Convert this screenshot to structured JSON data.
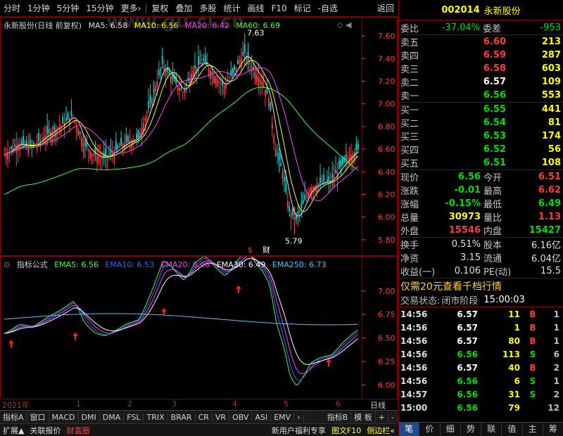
{
  "toolbar": [
    "分时",
    "1分钟",
    "5分钟",
    "15分钟",
    "更多›",
    "复权",
    "叠加",
    "多股",
    "统计",
    "画线",
    "F10",
    "标记",
    "-自选",
    "返回"
  ],
  "watermark": "www.gu-ci.cn",
  "main_legend": {
    "title": "永新股份(日线 前复权)",
    "ma5": "MA5: 6.58",
    "ma10": "MA10: 6.56",
    "ma20": "MA20: 6.42",
    "ma60": "MA60: 6.69"
  },
  "main_annot": {
    "high": "7.63",
    "low": "5.79",
    "s": "$",
    "cai": "财"
  },
  "main_axis": [
    "7.60",
    "7.40",
    "7.20",
    "7.00",
    "6.80",
    "6.60",
    "6.40",
    "6.20",
    "6.00",
    "5.80"
  ],
  "ind_legend": {
    "title": "指标公式",
    "ema5": "EMA5: 6.56",
    "ema10": "EMA10: 6.53",
    "ema20": "EMA20: 6.48",
    "ema30": "EMA30: 6.49",
    "ema250": "EMA250: 6.73"
  },
  "ind_axis": [
    "7.00",
    "6.75",
    "6.50",
    "6.25",
    "6.00"
  ],
  "dates": [
    "2021年",
    "1",
    "2",
    "3",
    "4",
    "5",
    "6"
  ],
  "period_label": "日线",
  "tabs": [
    "指标A",
    "窗口",
    "MACD",
    "DMI",
    "DMA",
    "FSL",
    "TRIX",
    "BRAR",
    "CR",
    "VR",
    "OBV",
    "ASI",
    "EMV",
    "›",
    "指标B",
    "模 板",
    "+",
    "-"
  ],
  "bottom": [
    "扩展▲",
    "关联报价",
    "财富圈",
    "新用户福利专享",
    "图文F10",
    "侧边栏«"
  ],
  "stock": {
    "code": "002014",
    "name": "永新股份"
  },
  "weibi": {
    "label1": "委比",
    "val1": "-37.04%",
    "label2": "委差",
    "val2": "-953"
  },
  "asks": [
    {
      "label": "卖五",
      "price": "6.60",
      "vol": "213"
    },
    {
      "label": "卖四",
      "price": "6.59",
      "vol": "287"
    },
    {
      "label": "卖三",
      "price": "6.58",
      "vol": "603"
    },
    {
      "label": "卖二",
      "price": "6.57",
      "vol": "109"
    },
    {
      "label": "卖一",
      "price": "6.56",
      "vol": "553"
    }
  ],
  "bids": [
    {
      "label": "买一",
      "price": "6.55",
      "vol": "441"
    },
    {
      "label": "买二",
      "price": "6.54",
      "vol": "81"
    },
    {
      "label": "买三",
      "price": "6.53",
      "vol": "174"
    },
    {
      "label": "买四",
      "price": "6.52",
      "vol": "56"
    },
    {
      "label": "买五",
      "price": "6.51",
      "vol": "108"
    }
  ],
  "stats": [
    {
      "l1": "现价",
      "v1": "6.56",
      "l2": "今开",
      "v2": "6.51"
    },
    {
      "l1": "涨跌",
      "v1": "-0.01",
      "l2": "最高",
      "v2": "6.62"
    },
    {
      "l1": "涨幅",
      "v1": "-0.15%",
      "l2": "最低",
      "v2": "6.49"
    },
    {
      "l1": "总量",
      "v1": "30973",
      "l2": "量比",
      "v2": "1.13"
    },
    {
      "l1": "外盘",
      "v1": "15546",
      "l2": "内盘",
      "v2": "15427"
    }
  ],
  "stats2": [
    {
      "l1": "换手",
      "v1": "0.51%",
      "l2": "股本",
      "v2": "6.16亿"
    },
    {
      "l1": "净资",
      "v1": "3.15",
      "l2": "流通",
      "v2": "6.04亿"
    },
    {
      "l1": "收益(一)",
      "v1": "0.106",
      "l2": "PE(动)",
      "v2": "15.5"
    }
  ],
  "promo": "仅需20元查看千档行情",
  "trade_status": {
    "label": "交易状态:",
    "value": "闭市阶段",
    "time": "15:00:03"
  },
  "ticks": [
    {
      "t": "14:56",
      "p": "6.57",
      "v": "11",
      "bs": "B",
      "n": "1"
    },
    {
      "t": "14:56",
      "p": "6.57",
      "v": "1",
      "bs": "B",
      "n": "1"
    },
    {
      "t": "14:56",
      "p": "6.57",
      "v": "80",
      "bs": "B",
      "n": "1"
    },
    {
      "t": "14:56",
      "p": "6.56",
      "v": "113",
      "bs": "S",
      "n": "6"
    },
    {
      "t": "14:56",
      "p": "6.57",
      "v": "40",
      "bs": "B",
      "n": "2"
    },
    {
      "t": "14:56",
      "p": "6.56",
      "v": "6",
      "bs": "S",
      "n": "1"
    },
    {
      "t": "14:57",
      "p": "6.56",
      "v": "31",
      "bs": "S",
      "n": "2"
    },
    {
      "t": "15:00",
      "p": "6.56",
      "v": "79",
      "bs": "",
      "n": "12"
    }
  ],
  "right_tabs": [
    "笔",
    "价",
    "细",
    "势",
    "联",
    "值",
    "主",
    "筹"
  ]
}
